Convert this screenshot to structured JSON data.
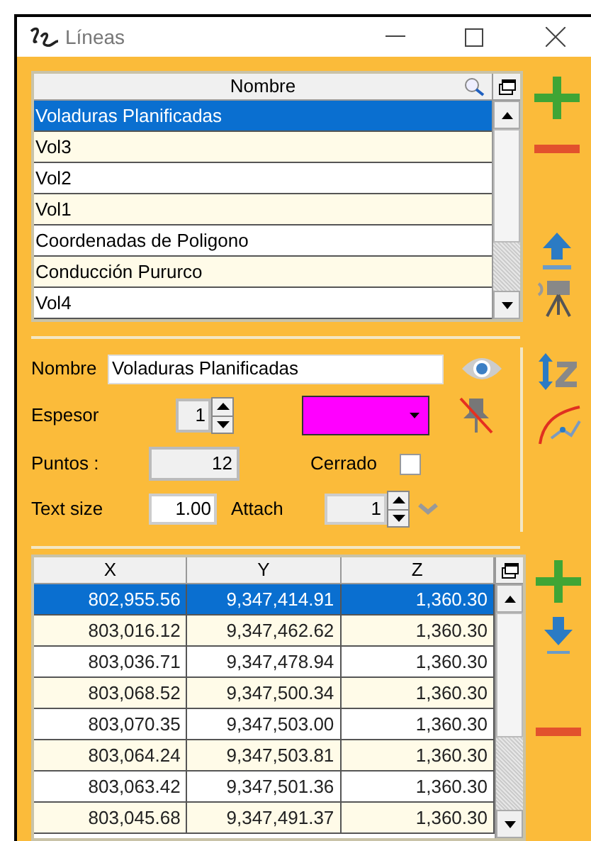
{
  "window": {
    "title": "Líneas"
  },
  "lines_list": {
    "header": "Nombre",
    "items": [
      {
        "name": "Voladuras Planificadas",
        "selected": true
      },
      {
        "name": "Vol3",
        "selected": false
      },
      {
        "name": "Vol2",
        "selected": false
      },
      {
        "name": "Vol1",
        "selected": false
      },
      {
        "name": "Coordenadas de Poligono",
        "selected": false
      },
      {
        "name": "Conducción Pururco",
        "selected": false
      },
      {
        "name": "Vol4",
        "selected": false
      }
    ]
  },
  "form": {
    "name_label": "Nombre",
    "name_value": "Voladuras Planificadas",
    "thickness_label": "Espesor",
    "thickness_value": "1",
    "color": "#ff00ff",
    "points_label": "Puntos :",
    "points_value": "12",
    "closed_label": "Cerrado",
    "closed_checked": false,
    "text_size_label": "Text size",
    "text_size_value": "1.00",
    "attach_label": "Attach",
    "attach_value": "1"
  },
  "points_table": {
    "columns": [
      "X",
      "Y",
      "Z"
    ],
    "rows": [
      {
        "cells": [
          "802,955.56",
          "9,347,414.91",
          "1,360.30"
        ],
        "selected": true
      },
      {
        "cells": [
          "803,016.12",
          "9,347,462.62",
          "1,360.30"
        ],
        "selected": false
      },
      {
        "cells": [
          "803,036.71",
          "9,347,478.94",
          "1,360.30"
        ],
        "selected": false
      },
      {
        "cells": [
          "803,068.52",
          "9,347,500.34",
          "1,360.30"
        ],
        "selected": false
      },
      {
        "cells": [
          "803,070.35",
          "9,347,503.00",
          "1,360.30"
        ],
        "selected": false
      },
      {
        "cells": [
          "803,064.24",
          "9,347,503.81",
          "1,360.30"
        ],
        "selected": false
      },
      {
        "cells": [
          "803,063.42",
          "9,347,501.36",
          "1,360.30"
        ],
        "selected": false
      },
      {
        "cells": [
          "803,045.68",
          "9,347,491.37",
          "1,360.30"
        ],
        "selected": false
      }
    ]
  }
}
